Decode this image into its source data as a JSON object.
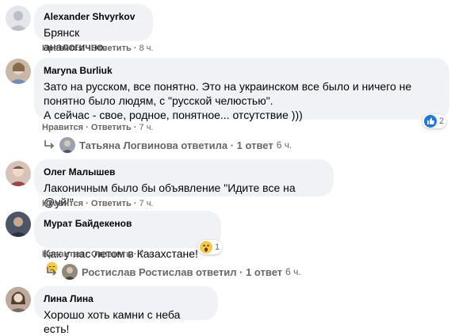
{
  "actions": {
    "like": "Нравится",
    "reply": "Ответить",
    "sep": "·"
  },
  "comments": [
    {
      "author": "Alexander Shvyrkov",
      "text": "Брянск аналогично.",
      "time": "8 ч."
    },
    {
      "author": "Maryna Burliuk",
      "text": "Зато на русском, все понятно. Это на украинском все было и ничего не\nпонятно было людям, с \"русской челюстью\".\nА сейчас - свое, родное, понятное... отсутствие )))",
      "time": "7 ч.",
      "reactions": "2"
    },
    {
      "author": "Олег Малышев",
      "text": "Лаконичным было бы объявление \"Идите все на @уй!\"",
      "time": "7 ч."
    },
    {
      "author": "Мурат Байдекенов",
      "text": "Как у нас летом в Казахстане!",
      "time": "7 ч.",
      "reactions": "1"
    },
    {
      "author": "Лина Лина",
      "text": "Хорошо хоть камни с неба есть!"
    }
  ],
  "replies": [
    {
      "text": "Татьяна Логвинова ответила · 1 ответ",
      "time": "6 ч."
    },
    {
      "text": "Ростислав Ростислав ответил · 1 ответ",
      "time": "6 ч."
    }
  ],
  "colors": {
    "bubble": "#f0f2f5",
    "meta": "#65676b",
    "like_blue": "#1877f2"
  }
}
